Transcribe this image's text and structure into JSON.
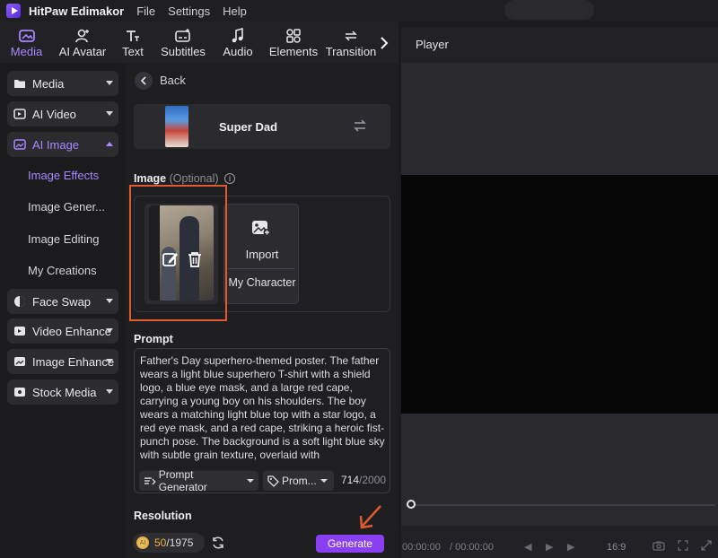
{
  "app": {
    "title": "HitPaw Edimakor",
    "menu": [
      "File",
      "Settings",
      "Help"
    ]
  },
  "toptabs": [
    {
      "label": "Media",
      "icon": "media-icon",
      "active": true
    },
    {
      "label": "AI Avatar",
      "icon": "avatar-icon"
    },
    {
      "label": "Text",
      "icon": "text-icon"
    },
    {
      "label": "Subtitles",
      "icon": "subtitles-icon"
    },
    {
      "label": "Audio",
      "icon": "audio-icon"
    },
    {
      "label": "Elements",
      "icon": "elements-icon"
    },
    {
      "label": "Transition",
      "icon": "transition-icon"
    }
  ],
  "sidebar": {
    "items": [
      {
        "label": "Media"
      },
      {
        "label": "AI Video"
      },
      {
        "label": "AI Image",
        "expanded": true
      },
      {
        "label": "Face Swap"
      },
      {
        "label": "Video Enhance"
      },
      {
        "label": "Image Enhance"
      },
      {
        "label": "Stock Media"
      }
    ],
    "subitems": [
      "Image Effects",
      "Image Gener...",
      "Image Editing",
      "My Creations"
    ]
  },
  "panel": {
    "back_label": "Back",
    "template_name": "Super Dad",
    "image_label": "Image",
    "image_optional": "(Optional)",
    "info_symbol": "i",
    "import_label": "Import",
    "my_character_label": "My Character",
    "prompt_label": "Prompt",
    "prompt_text": "Father's Day superhero-themed poster. The father wears a light blue superhero T-shirt with a shield logo, a blue eye mask, and a large red cape, carrying a young boy on his shoulders. The boy wears a matching light blue top with a star logo, a red eye mask, and a red cape, striking a heroic fist-punch pose. The background is a soft light blue sky with subtle grain texture, overlaid with",
    "prompt_generator_label": "Prompt Generator",
    "prompt_preset_label": "Prom...",
    "char_count": "714",
    "char_max": "/2000",
    "resolution_label": "Resolution",
    "credits_used": "50",
    "credits_total": "/1975",
    "coin_text": "AI",
    "generate_label": "Generate"
  },
  "player": {
    "title": "Player",
    "time_current": "00:00:00",
    "time_total": "/ 00:00:00",
    "aspect": "16:9"
  },
  "colors": {
    "accent": "#a987ff",
    "generate": "#8a3ff0",
    "annotation": "#e05a2f"
  }
}
